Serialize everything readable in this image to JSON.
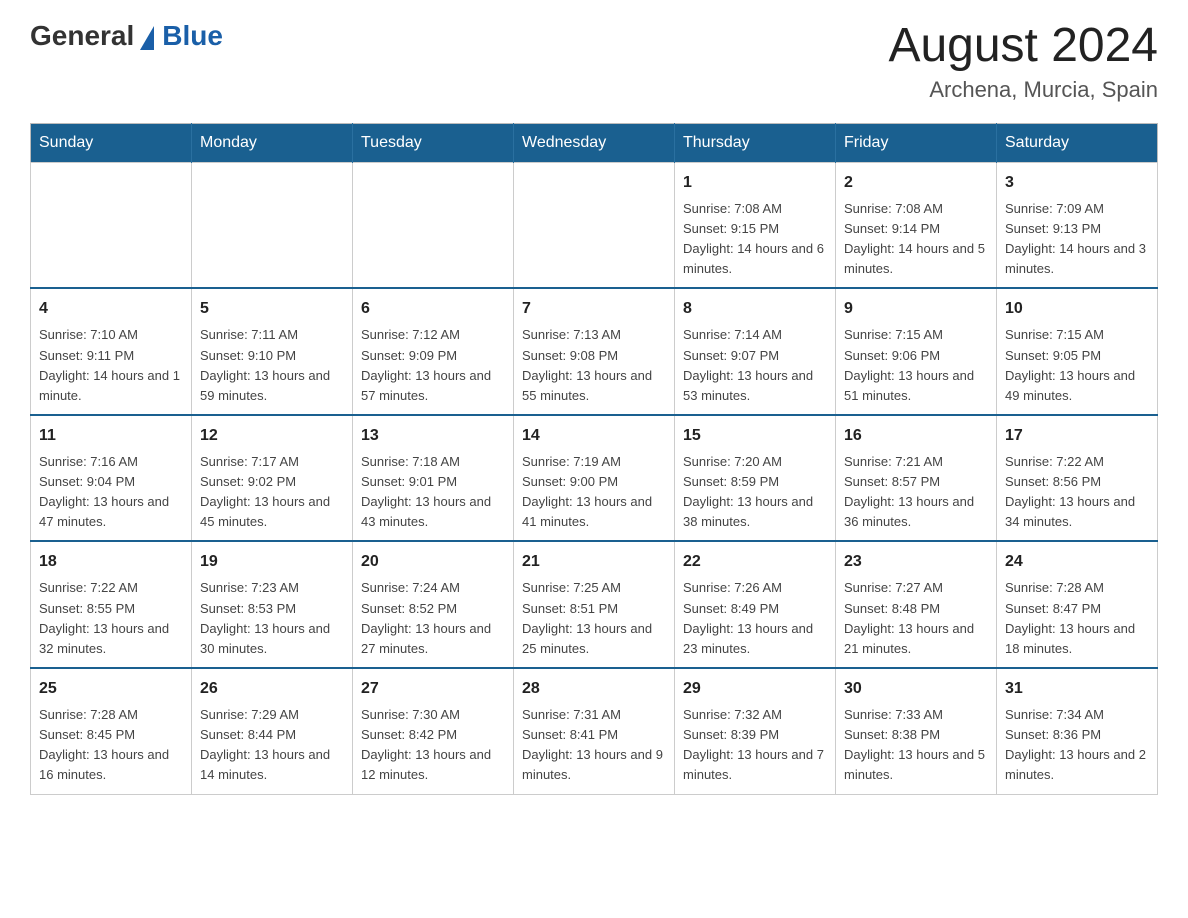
{
  "header": {
    "logo_general": "General",
    "logo_blue": "Blue",
    "title": "August 2024",
    "subtitle": "Archena, Murcia, Spain"
  },
  "weekdays": [
    "Sunday",
    "Monday",
    "Tuesday",
    "Wednesday",
    "Thursday",
    "Friday",
    "Saturday"
  ],
  "weeks": [
    [
      {
        "day": "",
        "info": ""
      },
      {
        "day": "",
        "info": ""
      },
      {
        "day": "",
        "info": ""
      },
      {
        "day": "",
        "info": ""
      },
      {
        "day": "1",
        "info": "Sunrise: 7:08 AM\nSunset: 9:15 PM\nDaylight: 14 hours and 6 minutes."
      },
      {
        "day": "2",
        "info": "Sunrise: 7:08 AM\nSunset: 9:14 PM\nDaylight: 14 hours and 5 minutes."
      },
      {
        "day": "3",
        "info": "Sunrise: 7:09 AM\nSunset: 9:13 PM\nDaylight: 14 hours and 3 minutes."
      }
    ],
    [
      {
        "day": "4",
        "info": "Sunrise: 7:10 AM\nSunset: 9:11 PM\nDaylight: 14 hours and 1 minute."
      },
      {
        "day": "5",
        "info": "Sunrise: 7:11 AM\nSunset: 9:10 PM\nDaylight: 13 hours and 59 minutes."
      },
      {
        "day": "6",
        "info": "Sunrise: 7:12 AM\nSunset: 9:09 PM\nDaylight: 13 hours and 57 minutes."
      },
      {
        "day": "7",
        "info": "Sunrise: 7:13 AM\nSunset: 9:08 PM\nDaylight: 13 hours and 55 minutes."
      },
      {
        "day": "8",
        "info": "Sunrise: 7:14 AM\nSunset: 9:07 PM\nDaylight: 13 hours and 53 minutes."
      },
      {
        "day": "9",
        "info": "Sunrise: 7:15 AM\nSunset: 9:06 PM\nDaylight: 13 hours and 51 minutes."
      },
      {
        "day": "10",
        "info": "Sunrise: 7:15 AM\nSunset: 9:05 PM\nDaylight: 13 hours and 49 minutes."
      }
    ],
    [
      {
        "day": "11",
        "info": "Sunrise: 7:16 AM\nSunset: 9:04 PM\nDaylight: 13 hours and 47 minutes."
      },
      {
        "day": "12",
        "info": "Sunrise: 7:17 AM\nSunset: 9:02 PM\nDaylight: 13 hours and 45 minutes."
      },
      {
        "day": "13",
        "info": "Sunrise: 7:18 AM\nSunset: 9:01 PM\nDaylight: 13 hours and 43 minutes."
      },
      {
        "day": "14",
        "info": "Sunrise: 7:19 AM\nSunset: 9:00 PM\nDaylight: 13 hours and 41 minutes."
      },
      {
        "day": "15",
        "info": "Sunrise: 7:20 AM\nSunset: 8:59 PM\nDaylight: 13 hours and 38 minutes."
      },
      {
        "day": "16",
        "info": "Sunrise: 7:21 AM\nSunset: 8:57 PM\nDaylight: 13 hours and 36 minutes."
      },
      {
        "day": "17",
        "info": "Sunrise: 7:22 AM\nSunset: 8:56 PM\nDaylight: 13 hours and 34 minutes."
      }
    ],
    [
      {
        "day": "18",
        "info": "Sunrise: 7:22 AM\nSunset: 8:55 PM\nDaylight: 13 hours and 32 minutes."
      },
      {
        "day": "19",
        "info": "Sunrise: 7:23 AM\nSunset: 8:53 PM\nDaylight: 13 hours and 30 minutes."
      },
      {
        "day": "20",
        "info": "Sunrise: 7:24 AM\nSunset: 8:52 PM\nDaylight: 13 hours and 27 minutes."
      },
      {
        "day": "21",
        "info": "Sunrise: 7:25 AM\nSunset: 8:51 PM\nDaylight: 13 hours and 25 minutes."
      },
      {
        "day": "22",
        "info": "Sunrise: 7:26 AM\nSunset: 8:49 PM\nDaylight: 13 hours and 23 minutes."
      },
      {
        "day": "23",
        "info": "Sunrise: 7:27 AM\nSunset: 8:48 PM\nDaylight: 13 hours and 21 minutes."
      },
      {
        "day": "24",
        "info": "Sunrise: 7:28 AM\nSunset: 8:47 PM\nDaylight: 13 hours and 18 minutes."
      }
    ],
    [
      {
        "day": "25",
        "info": "Sunrise: 7:28 AM\nSunset: 8:45 PM\nDaylight: 13 hours and 16 minutes."
      },
      {
        "day": "26",
        "info": "Sunrise: 7:29 AM\nSunset: 8:44 PM\nDaylight: 13 hours and 14 minutes."
      },
      {
        "day": "27",
        "info": "Sunrise: 7:30 AM\nSunset: 8:42 PM\nDaylight: 13 hours and 12 minutes."
      },
      {
        "day": "28",
        "info": "Sunrise: 7:31 AM\nSunset: 8:41 PM\nDaylight: 13 hours and 9 minutes."
      },
      {
        "day": "29",
        "info": "Sunrise: 7:32 AM\nSunset: 8:39 PM\nDaylight: 13 hours and 7 minutes."
      },
      {
        "day": "30",
        "info": "Sunrise: 7:33 AM\nSunset: 8:38 PM\nDaylight: 13 hours and 5 minutes."
      },
      {
        "day": "31",
        "info": "Sunrise: 7:34 AM\nSunset: 8:36 PM\nDaylight: 13 hours and 2 minutes."
      }
    ]
  ]
}
